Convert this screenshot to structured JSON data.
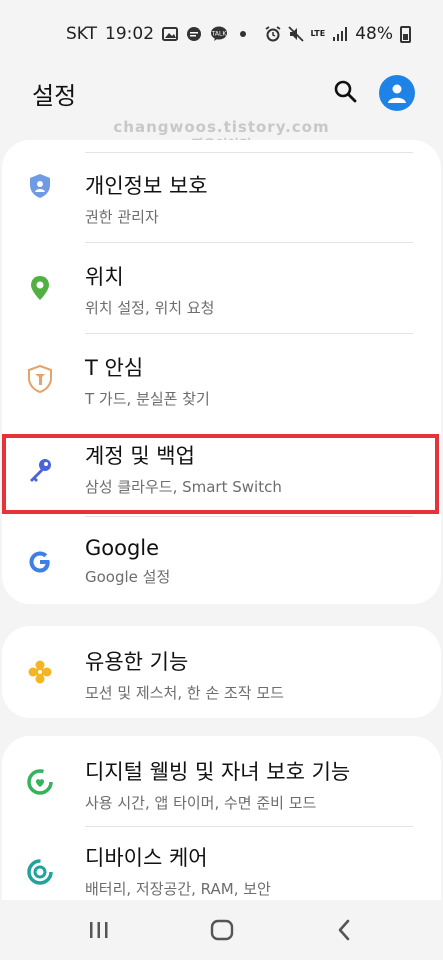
{
  "status_bar": {
    "carrier": "SKT",
    "time": "19:02",
    "network": "LTE",
    "battery": "48%"
  },
  "header": {
    "title": "설정"
  },
  "watermark": {
    "line1": "changwoos.tistory.com",
    "line2": "짱우이야기"
  },
  "settings": {
    "items": [
      {
        "label": "개인정보 보호",
        "sub": "권한 관리자",
        "icon": "privacy-shield-icon",
        "color": "#6f9be5"
      },
      {
        "label": "위치",
        "sub": "위치 설정, 위치 요청",
        "icon": "location-pin-icon",
        "color": "#52b043"
      },
      {
        "label": "T 안심",
        "sub": "T 가드, 분실폰 찾기",
        "icon": "t-guard-shield-icon",
        "color": "#e3a36a"
      },
      {
        "label": "계정 및 백업",
        "sub": "삼성 클라우드, Smart Switch",
        "icon": "key-icon",
        "color": "#4a63d8"
      },
      {
        "label": "Google",
        "sub": "Google 설정",
        "icon": "google-icon",
        "color": "#3d7fe6"
      },
      {
        "label": "유용한 기능",
        "sub": "모션 및 제스처, 한 손 조작 모드",
        "icon": "puzzle-flower-icon",
        "color": "#f5b522"
      },
      {
        "label": "디지털 웰빙 및 자녀 보호 기능",
        "sub": "사용 시간, 앱 타이머, 수면 준비 모드",
        "icon": "wellbeing-icon",
        "color": "#33b35b"
      },
      {
        "label": "디바이스 케어",
        "sub": "배터리, 저장공간, RAM, 보안",
        "icon": "device-care-icon",
        "color": "#1fa39a"
      }
    ]
  },
  "colors": {
    "highlight": "#e8323a",
    "accent": "#1e82e6"
  }
}
